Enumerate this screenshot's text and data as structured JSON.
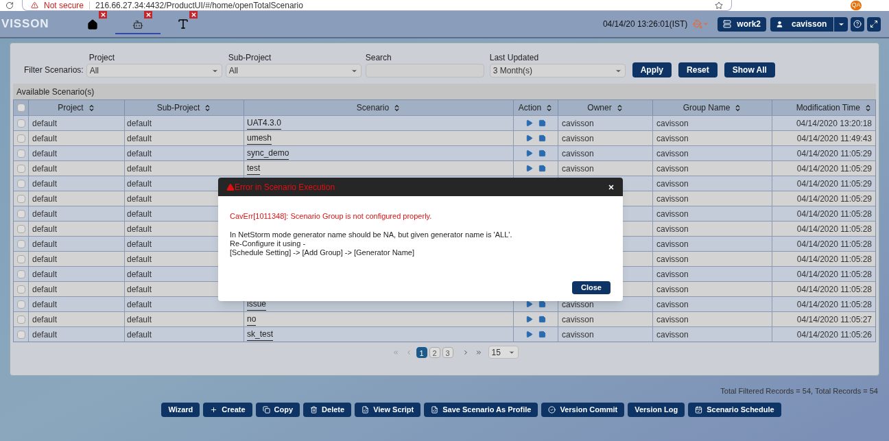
{
  "browser": {
    "security": "Not secure",
    "url": "216.66.27.34:4432/ProductUI/#/home/openTotalScenario",
    "avatar": "QA"
  },
  "header": {
    "logo": "VISSON",
    "tabs": [
      {
        "kind": "home",
        "selected": false
      },
      {
        "kind": "scenario",
        "selected": true
      },
      {
        "kind": "text",
        "selected": false
      }
    ],
    "datetime": "04/14/20 13:26:01(IST)",
    "workspace": "work2",
    "user": "cavisson"
  },
  "filters": {
    "label": "Filter Scenarios:",
    "project": {
      "label": "Project",
      "value": "All"
    },
    "subproject": {
      "label": "Sub-Project",
      "value": "All"
    },
    "search": {
      "label": "Search"
    },
    "last_updated": {
      "label": "Last Updated",
      "value": "3 Month(s)"
    },
    "buttons": [
      "Apply",
      "Reset",
      "Show All"
    ]
  },
  "table": {
    "title": "Available Scenario(s)",
    "all_checked": false,
    "columns": [
      "Project",
      "Sub-Project",
      "Scenario",
      "Action",
      "Owner",
      "Group Name",
      "Modification Time"
    ],
    "rows": [
      {
        "checked": false,
        "project": "default",
        "subproject": "default",
        "scenario": "UAT4.3.0",
        "actions": true,
        "owner": "cavisson",
        "group": "cavisson",
        "time": "04/14/2020 13:20:18"
      },
      {
        "checked": false,
        "project": "default",
        "subproject": "default",
        "scenario": "umesh",
        "actions": true,
        "owner": "cavisson",
        "group": "cavisson",
        "time": "04/14/2020 11:49:43"
      },
      {
        "checked": false,
        "project": "default",
        "subproject": "default",
        "scenario": "sync_demo",
        "actions": true,
        "owner": "cavisson",
        "group": "cavisson",
        "time": "04/14/2020 11:05:29"
      },
      {
        "checked": false,
        "project": "default",
        "subproject": "default",
        "scenario": "test",
        "actions": true,
        "owner": "cavisson",
        "group": "cavisson",
        "time": "04/14/2020 11:05:29"
      },
      {
        "checked": false,
        "project": "default",
        "subproject": "default",
        "group": "cavisson",
        "time": "04/14/2020 11:05:29"
      },
      {
        "checked": false,
        "project": "default",
        "subproject": "default",
        "group": "cavisson",
        "time": "04/14/2020 11:05:29"
      },
      {
        "checked": false,
        "project": "default",
        "subproject": "default",
        "group": "cavisson",
        "time": "04/14/2020 11:05:28"
      },
      {
        "checked": false,
        "project": "default",
        "subproject": "default",
        "group": "cavisson",
        "time": "04/14/2020 11:05:28"
      },
      {
        "checked": false,
        "project": "default",
        "subproject": "default",
        "group": "cavisson",
        "time": "04/14/2020 11:05:28"
      },
      {
        "checked": false,
        "project": "default",
        "subproject": "default",
        "group": "cavisson",
        "time": "04/14/2020 11:05:28"
      },
      {
        "checked": false,
        "project": "default",
        "subproject": "default",
        "group": "cavisson",
        "time": "04/14/2020 11:05:28"
      },
      {
        "checked": false,
        "project": "default",
        "subproject": "default",
        "group": "cavisson",
        "time": "04/14/2020 11:05:28"
      },
      {
        "checked": false,
        "project": "default",
        "subproject": "default",
        "scenario": "issue",
        "actions": true,
        "owner": "cavisson",
        "group": "cavisson",
        "time": "04/14/2020 11:05:28"
      },
      {
        "checked": false,
        "project": "default",
        "subproject": "default",
        "scenario": "no",
        "actions": true,
        "owner": "cavisson",
        "group": "cavisson",
        "time": "04/14/2020 11:05:27"
      },
      {
        "checked": false,
        "project": "default",
        "subproject": "default",
        "scenario": "sk_test",
        "actions": true,
        "owner": "cavisson",
        "group": "cavisson",
        "time": "04/14/2020 11:05:26"
      }
    ]
  },
  "pagination": {
    "pages": [
      {
        "label": "1",
        "selected": true
      },
      {
        "label": "2",
        "selected": false
      },
      {
        "label": "3",
        "selected": false
      }
    ],
    "page_size": "15"
  },
  "records": "Total Filtered Records = 54, Total Records = 54",
  "actions": [
    "Wizard",
    "Create",
    "Copy",
    "Delete",
    "View Script",
    "Save Scenario As Profile",
    "Version Commit",
    "Version Log",
    "Scenario Schedule"
  ],
  "dialog": {
    "title": "Error in Scenario Execution",
    "error": "CavErr[1011348]: Scenario Group is not configured properly.",
    "lines": [
      "In NetStorm mode generator name should be NA, but given generator name is 'ALL'.",
      "Re-Configure it using -",
      "[Schedule Setting] -> [Add Group] -> [Generator Name]"
    ],
    "button": "Close"
  }
}
